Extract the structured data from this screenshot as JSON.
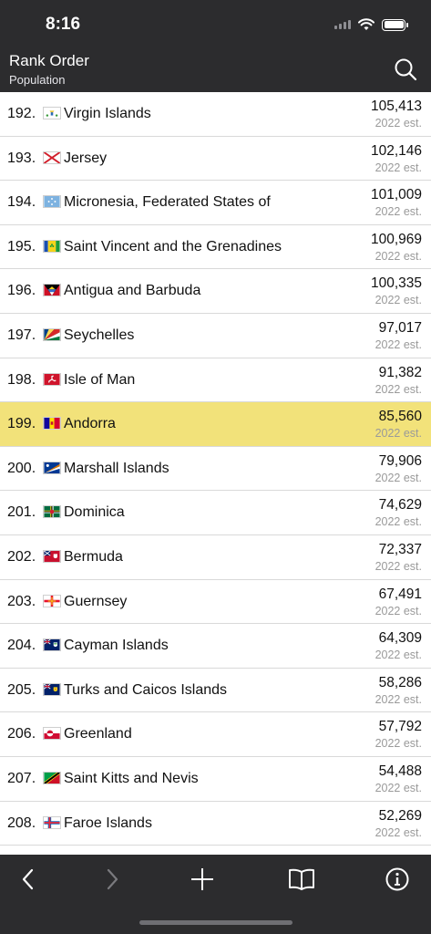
{
  "status": {
    "time": "8:16"
  },
  "header": {
    "title": "Rank Order",
    "subtitle": "Population",
    "search_icon": "search-icon"
  },
  "colors": {
    "bar_bg": "#2c2c2e",
    "highlight": "#f2e27a",
    "est_text": "#9a9a9a"
  },
  "rows": [
    {
      "rank": "192.",
      "name": "Virgin Islands",
      "pop": "105,413",
      "est": "2022 est.",
      "flag": "flag-virgin-islands"
    },
    {
      "rank": "193.",
      "name": "Jersey",
      "pop": "102,146",
      "est": "2022 est.",
      "flag": "flag-jersey"
    },
    {
      "rank": "194.",
      "name": "Micronesia, Federated States of",
      "pop": "101,009",
      "est": "2022 est.",
      "flag": "flag-micronesia"
    },
    {
      "rank": "195.",
      "name": "Saint Vincent and the Grenadines",
      "pop": "100,969",
      "est": "2022 est.",
      "flag": "flag-saint-vincent"
    },
    {
      "rank": "196.",
      "name": "Antigua and Barbuda",
      "pop": "100,335",
      "est": "2022 est.",
      "flag": "flag-antigua"
    },
    {
      "rank": "197.",
      "name": "Seychelles",
      "pop": "97,017",
      "est": "2022 est.",
      "flag": "flag-seychelles"
    },
    {
      "rank": "198.",
      "name": "Isle of Man",
      "pop": "91,382",
      "est": "2022 est.",
      "flag": "flag-isle-of-man"
    },
    {
      "rank": "199.",
      "name": "Andorra",
      "pop": "85,560",
      "est": "2022 est.",
      "flag": "flag-andorra",
      "highlighted": true
    },
    {
      "rank": "200.",
      "name": "Marshall Islands",
      "pop": "79,906",
      "est": "2022 est.",
      "flag": "flag-marshall-islands"
    },
    {
      "rank": "201.",
      "name": "Dominica",
      "pop": "74,629",
      "est": "2022 est.",
      "flag": "flag-dominica"
    },
    {
      "rank": "202.",
      "name": "Bermuda",
      "pop": "72,337",
      "est": "2022 est.",
      "flag": "flag-bermuda"
    },
    {
      "rank": "203.",
      "name": "Guernsey",
      "pop": "67,491",
      "est": "2022 est.",
      "flag": "flag-guernsey"
    },
    {
      "rank": "204.",
      "name": "Cayman Islands",
      "pop": "64,309",
      "est": "2022 est.",
      "flag": "flag-cayman-islands"
    },
    {
      "rank": "205.",
      "name": "Turks and Caicos Islands",
      "pop": "58,286",
      "est": "2022 est.",
      "flag": "flag-turks-caicos"
    },
    {
      "rank": "206.",
      "name": "Greenland",
      "pop": "57,792",
      "est": "2022 est.",
      "flag": "flag-greenland"
    },
    {
      "rank": "207.",
      "name": "Saint Kitts and Nevis",
      "pop": "54,488",
      "est": "2022 est.",
      "flag": "flag-saint-kitts"
    },
    {
      "rank": "208.",
      "name": "Faroe Islands",
      "pop": "52,269",
      "est": "2022 est.",
      "flag": "flag-faroe-islands"
    }
  ],
  "toolbar": {
    "back_icon": "chevron-left-icon",
    "forward_icon": "chevron-right-icon",
    "add_icon": "plus-icon",
    "bookmarks_icon": "book-icon",
    "info_icon": "info-icon"
  }
}
